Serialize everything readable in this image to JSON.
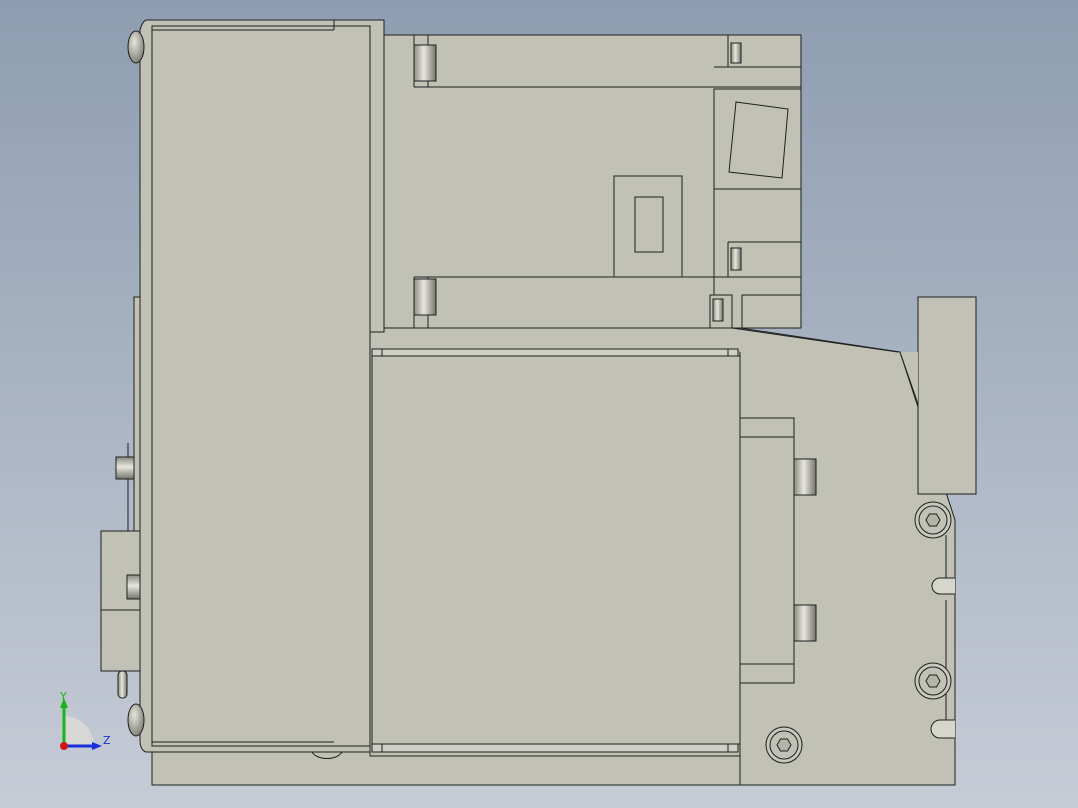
{
  "viewport": {
    "background_top": "#8e9db1",
    "background_bottom": "#c6ccd6",
    "part_fill": "#c1c1b6",
    "part_fill_light": "#cdcdc3",
    "edge_color": "#1f1f1f"
  },
  "triad": {
    "y_label": "Y",
    "z_label": "Z",
    "y_color": "#18b418",
    "z_color": "#1a2fd9",
    "x_color": "#d01616"
  }
}
